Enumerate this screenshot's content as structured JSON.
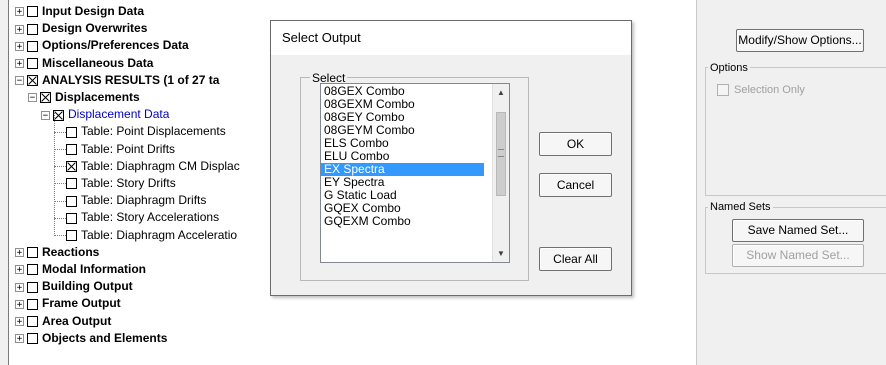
{
  "tree": {
    "items": [
      {
        "label": "Input Design Data",
        "expander": "⊞",
        "checked": false,
        "bold": true
      },
      {
        "label": "Design Overwrites",
        "expander": "⊞",
        "checked": false,
        "bold": true
      },
      {
        "label": "Options/Preferences Data",
        "expander": "⊞",
        "checked": false,
        "bold": true
      },
      {
        "label": "Miscellaneous Data",
        "expander": "⊞",
        "checked": false,
        "bold": true
      },
      {
        "label": "ANALYSIS RESULTS  (1 of 27 ta",
        "expander": "⊟",
        "checked": true,
        "bold": true
      },
      {
        "label": "Displacements",
        "expander": "⊟",
        "checked": true,
        "bold": true
      },
      {
        "label": "Displacement Data",
        "expander": "⊟",
        "checked": true,
        "bold": false
      },
      {
        "label": "Table:  Point Displacements",
        "checked": false
      },
      {
        "label": "Table:  Point Drifts",
        "checked": false
      },
      {
        "label": "Table:  Diaphragm CM Displac",
        "checked": true
      },
      {
        "label": "Table:  Story Drifts",
        "checked": false
      },
      {
        "label": "Table:  Diaphragm Drifts",
        "checked": false
      },
      {
        "label": "Table:  Story Accelerations",
        "checked": false
      },
      {
        "label": "Table:  Diaphragm Acceleratio",
        "checked": false
      },
      {
        "label": "Reactions",
        "expander": "⊞",
        "checked": false,
        "bold": true
      },
      {
        "label": "Modal Information",
        "expander": "⊞",
        "checked": false,
        "bold": true
      },
      {
        "label": "Building Output",
        "expander": "⊞",
        "checked": false,
        "bold": true
      },
      {
        "label": "Frame Output",
        "expander": "⊞",
        "checked": false,
        "bold": true
      },
      {
        "label": "Area Output",
        "expander": "⊞",
        "checked": false,
        "bold": true
      },
      {
        "label": "Objects and Elements",
        "expander": "⊞",
        "checked": false,
        "bold": true
      }
    ]
  },
  "right_panel": {
    "modify_button": "Modify/Show Options...",
    "options_legend": "Options",
    "selection_only_label": "Selection Only",
    "selection_only_checked": false,
    "named_sets_legend": "Named Sets",
    "save_named_set_button": "Save Named Set...",
    "show_named_set_button": "Show Named Set..."
  },
  "dialog": {
    "title": "Select Output",
    "select_legend": "Select",
    "options": [
      "08GEX Combo",
      "08GEXM Combo",
      "08GEY Combo",
      "08GEYM Combo",
      "ELS Combo",
      "ELU Combo",
      "EX Spectra",
      "EY Spectra",
      "G Static Load",
      "GQEX Combo",
      "GQEXM Combo"
    ],
    "selected_option": "EX Spectra",
    "ok_label": "OK",
    "cancel_label": "Cancel",
    "clear_all_label": "Clear All"
  },
  "colors": {
    "selection": "#3399ff",
    "tree_link": "#0000d0",
    "panel_bg": "#f0f0f0"
  },
  "icons": {
    "up_arrow": "scroll-up-arrow-icon",
    "down_arrow": "scroll-down-arrow-icon",
    "grip": "scroll-thumb-grip-icon"
  }
}
